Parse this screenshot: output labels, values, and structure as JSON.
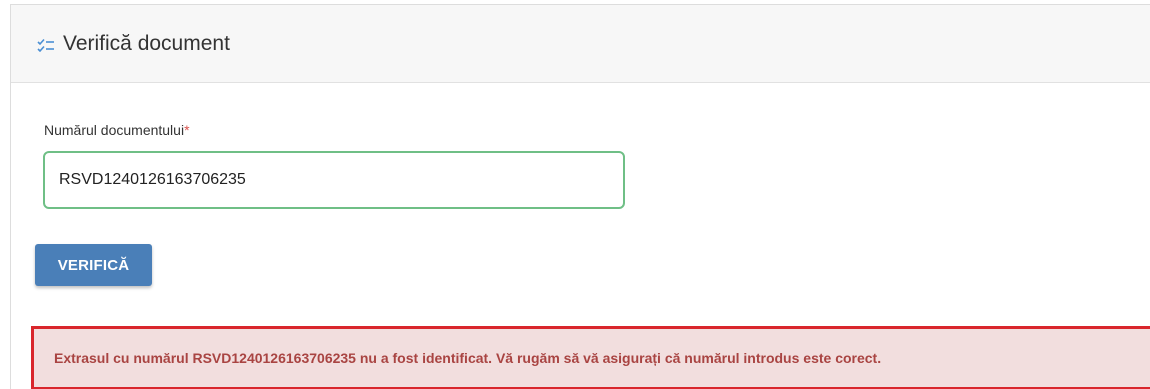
{
  "card": {
    "title": "Verifică document",
    "title_icon": "checklist-icon"
  },
  "form": {
    "label": "Numărul documentului",
    "required_marker": "*",
    "input_value": "RSVD1240126163706235",
    "submit_label": "VERIFICĂ"
  },
  "alert": {
    "message": "Extrasul cu numărul RSVD1240126163706235 nu a fost identificat. Vă rugăm să vă asigurați că numărul introdus este corect."
  },
  "colors": {
    "accent_blue": "#4a7fb8",
    "input_border_valid": "#6fbf86",
    "error_border": "#d9262c",
    "error_background": "#f2dede",
    "error_text": "#a94442"
  }
}
